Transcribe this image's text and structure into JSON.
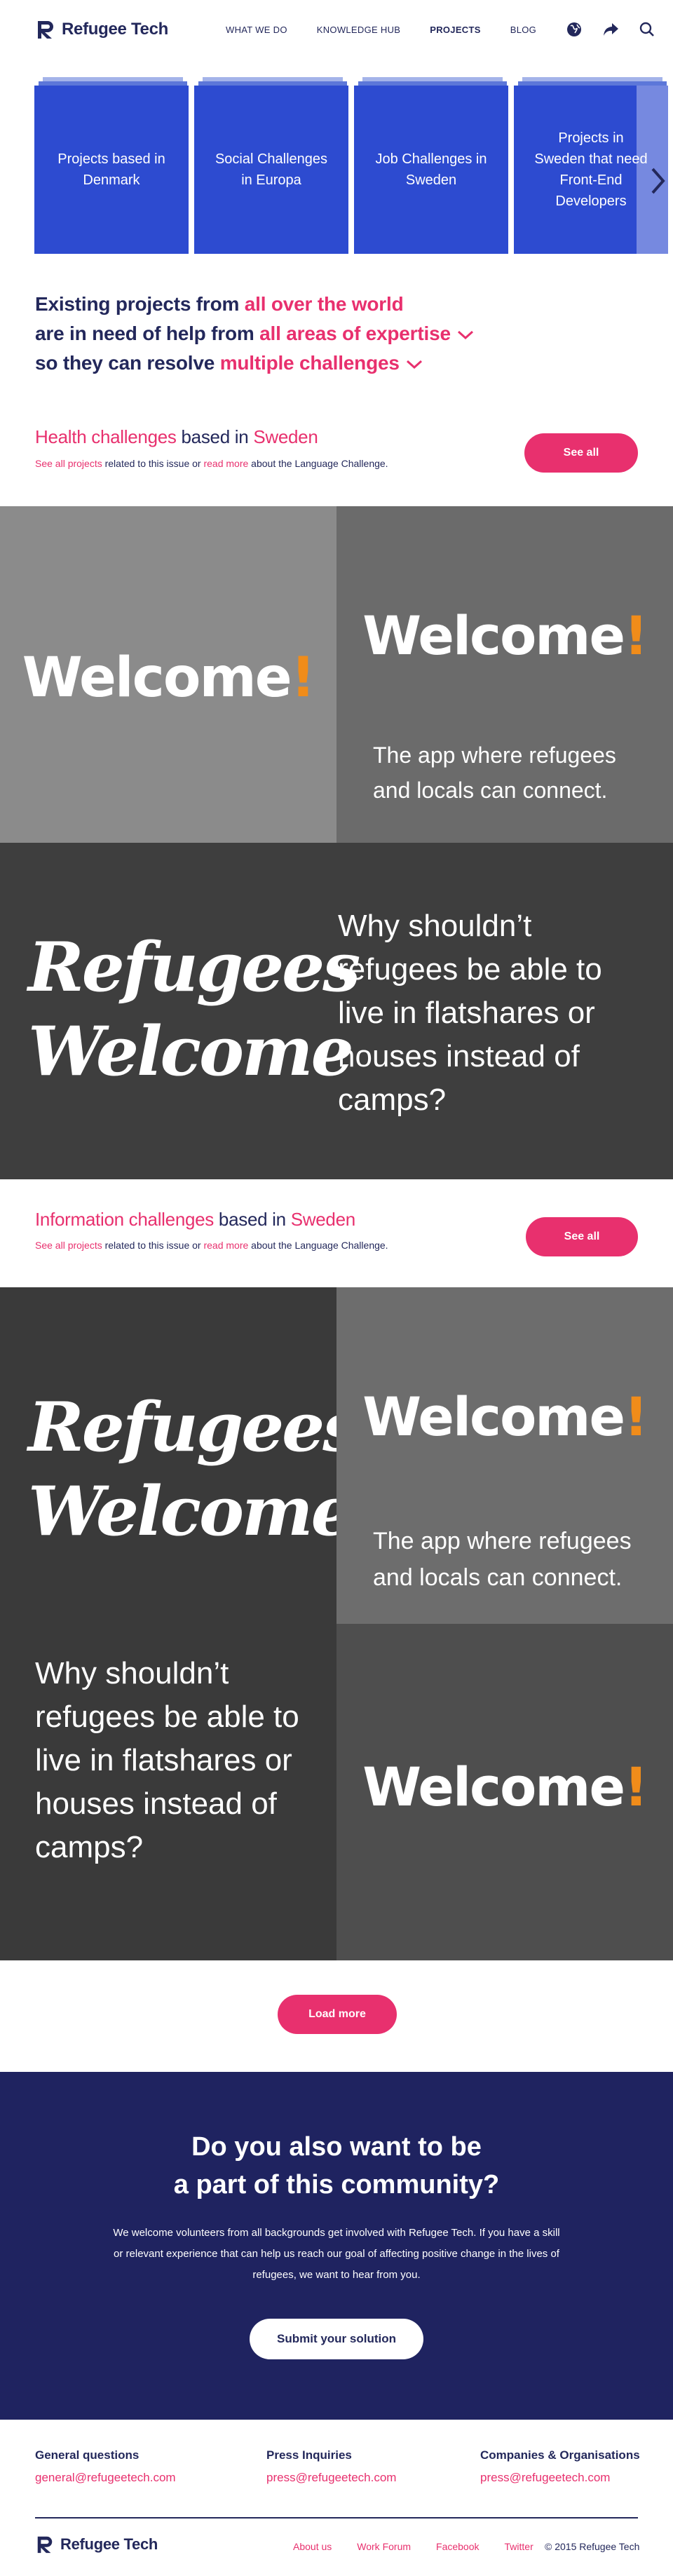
{
  "header": {
    "logo_text": "Refugee Tech",
    "nav": [
      "WHAT WE DO",
      "KNOWLEDGE HUB",
      "PROJECTS",
      "BLOG"
    ],
    "active_nav": "PROJECTS",
    "icons": [
      "globe-icon",
      "share-icon",
      "search-icon"
    ]
  },
  "carousel": {
    "cards": [
      "Projects based in Denmark",
      "Social Challenges in Europa",
      "Job Challenges in Sweden",
      "Projects in Sweden that need Front-End Developers"
    ],
    "next_icon": "chevron-right-icon"
  },
  "intro": {
    "line1_a": "Existing projects from ",
    "line1_b": "all over the world",
    "line2_a": "are in need of help from ",
    "line2_b": "all areas of expertise",
    "line3_a": "so they can resolve ",
    "line3_b": "multiple challenges"
  },
  "challenges": [
    {
      "topic": "Health challenges",
      "mid": " based in ",
      "place": "Sweden",
      "sub_link1": "See all projects",
      "sub_mid": " related to this issue or ",
      "sub_link2": "read more",
      "sub_end": " about the Language Challenge.",
      "button": "See all"
    },
    {
      "topic": "Information challenges",
      "mid": " based in ",
      "place": "Sweden",
      "sub_link1": "See all projects",
      "sub_mid": " related to this issue or ",
      "sub_link2": "read more",
      "sub_end": " about the Language Challenge.",
      "button": "See all"
    }
  ],
  "tiles": {
    "welcome": "Welcome",
    "bang": "!",
    "app_text": "The app where refugees and locals can connect.",
    "script_line1": "Refugees",
    "script_line2": "Welcome",
    "why_text": "Why shouldn’t refugees be able to live in flatshares or houses instead of camps?"
  },
  "load_more": "Load more",
  "community": {
    "title_line1": "Do you also want to be",
    "title_line2": "a part of this community?",
    "text": "We welcome volunteers from all backgrounds get involved with Refugee Tech. If you have a skill or relevant experience that can help us reach our goal of affecting positive change in the lives of refugees, we want to hear from you.",
    "button": "Submit your solution"
  },
  "footer": {
    "cols": [
      {
        "heading": "General questions",
        "email": "general@refugeetech.com"
      },
      {
        "heading": "Press Inquiries",
        "email": "press@refugeetech.com"
      },
      {
        "heading": "Companies & Organisations",
        "email": "press@refugeetech.com"
      }
    ],
    "logo_text": "Refugee Tech",
    "links": [
      "About us",
      "Work Forum",
      "Facebook",
      "Twitter"
    ],
    "copyright": "© 2015 Refugee Tech"
  },
  "colors": {
    "navy": "#23285b",
    "pink": "#e8306e",
    "card_blue": "#2d4bd0",
    "orange": "#f08c1a"
  }
}
